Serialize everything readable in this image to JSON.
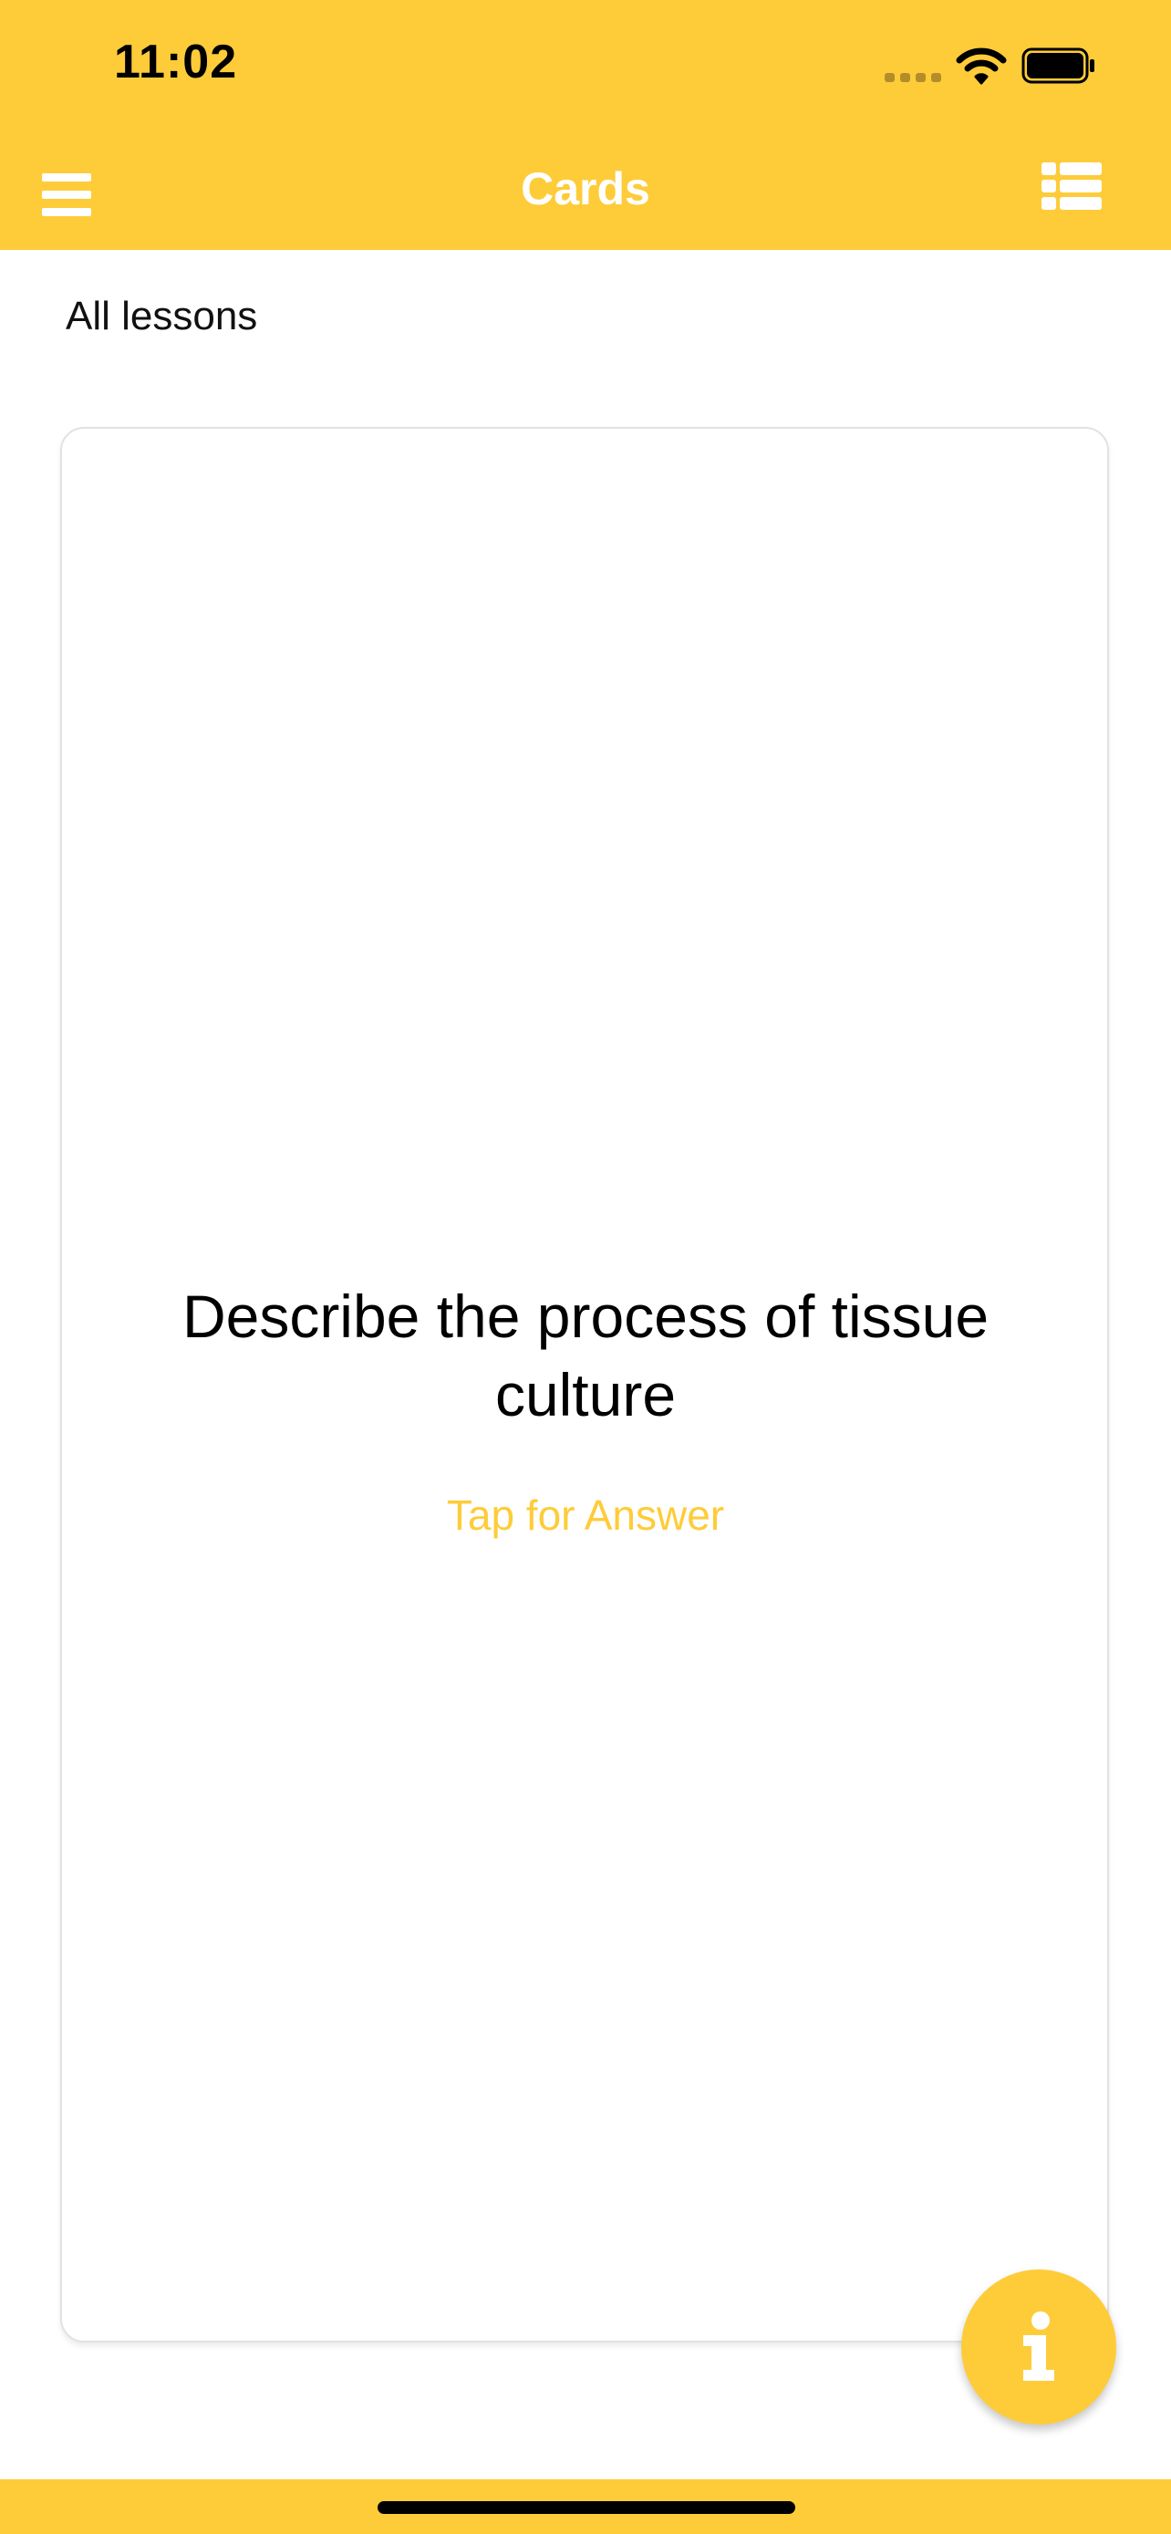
{
  "status_bar": {
    "time": "11:02"
  },
  "nav": {
    "title": "Cards",
    "menu_icon": "hamburger-icon",
    "list_icon": "list-icon"
  },
  "filter": {
    "label": "All lessons"
  },
  "card": {
    "question": "Describe the process of tissue culture",
    "tap_hint": "Tap for Answer"
  },
  "fab": {
    "icon": "info-icon"
  },
  "colors": {
    "accent": "#FECC39",
    "background": "#FFFFFF",
    "text": "#000000"
  }
}
